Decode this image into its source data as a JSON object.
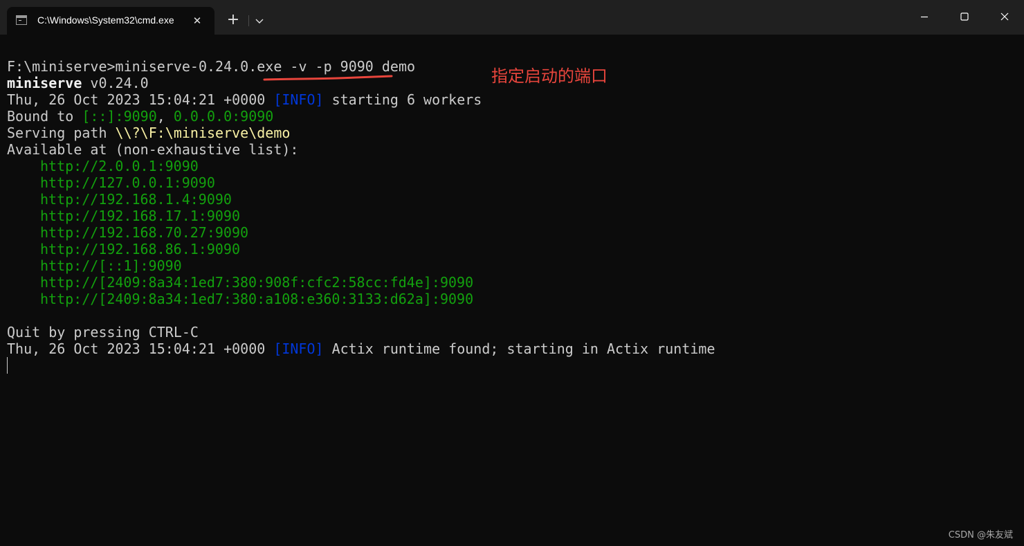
{
  "tab": {
    "title": "C:\\Windows\\System32\\cmd.exe",
    "icon": "cmd-console-icon",
    "close_glyph": "✕"
  },
  "titlebar": {
    "new_tab_glyph": "+",
    "dropdown_icon": "chevron-down-icon",
    "minimize_icon": "minimize-icon",
    "maximize_icon": "maximize-icon",
    "close_icon": "close-icon"
  },
  "terminal": {
    "prompt": "F:\\miniserve>",
    "command": "miniserve-0.24.0.exe -v -p 9090 demo",
    "version_name": "miniserve",
    "version_number": " v0.24.0",
    "log1": {
      "timestamp": "Thu, 26 Oct 2023 15:04:21 +0000 ",
      "level": "[INFO]",
      "message": " starting 6 workers"
    },
    "bound": {
      "prefix": "Bound to ",
      "addr1": "[::]:9090",
      "sep": ", ",
      "addr2": "0.0.0.0:9090"
    },
    "serving": {
      "prefix": "Serving path ",
      "path": "\\\\?\\F:\\miniserve\\demo"
    },
    "available_label": "Available at (non-exhaustive list):",
    "urls": [
      "http://2.0.0.1:9090",
      "http://127.0.0.1:9090",
      "http://192.168.1.4:9090",
      "http://192.168.17.1:9090",
      "http://192.168.70.27:9090",
      "http://192.168.86.1:9090",
      "http://[::1]:9090",
      "http://[2409:8a34:1ed7:380:908f:cfc2:58cc:fd4e]:9090",
      "http://[2409:8a34:1ed7:380:a108:e360:3133:d62a]:9090"
    ],
    "quit_text": "Quit by pressing CTRL-C",
    "log2": {
      "timestamp": "Thu, 26 Oct 2023 15:04:21 +0000 ",
      "level": "[INFO]",
      "message": " Actix runtime found; starting in Actix runtime"
    }
  },
  "annotation": {
    "text": "指定启动的端口",
    "color": "#e8453c"
  },
  "watermark": "CSDN @朱友斌",
  "colors": {
    "background": "#0c0c0c",
    "titlebar": "#202020",
    "text": "#cccccc",
    "green": "#13a10e",
    "blue": "#0037da",
    "yellow": "#f9f1a5"
  }
}
